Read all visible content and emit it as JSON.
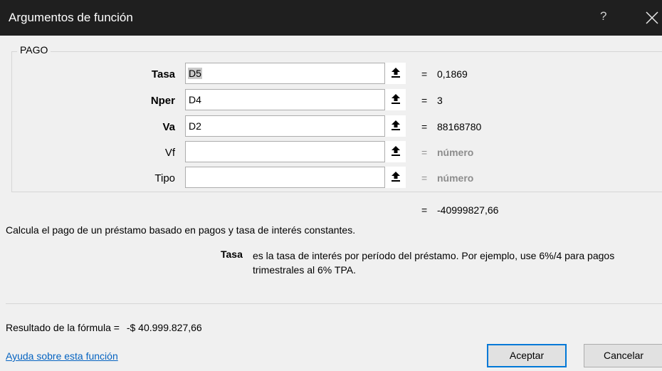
{
  "dialog": {
    "title": "Argumentos de función",
    "help_glyph": "?",
    "close_label": "X"
  },
  "function_name": "PAGO",
  "arguments": [
    {
      "label": "Tasa",
      "value": "D5",
      "result": "0,1869",
      "required": true
    },
    {
      "label": "Nper",
      "value": "D4",
      "result": "3",
      "required": true
    },
    {
      "label": "Va",
      "value": "D2",
      "result": "88168780",
      "required": true
    },
    {
      "label": "Vf",
      "value": "",
      "result": "número",
      "required": false
    },
    {
      "label": "Tipo",
      "value": "",
      "result": "número",
      "required": false
    }
  ],
  "equals_sign": "=",
  "total_result": "-40999827,66",
  "function_description": "Calcula el pago de un préstamo basado en pagos y tasa de interés constantes.",
  "argument_help": {
    "name": "Tasa",
    "text": "es la tasa de interés por período del préstamo. Por ejemplo, use 6%/4 para pagos trimestrales al 6% TPA."
  },
  "formula_result": {
    "label": "Resultado de la fórmula =",
    "value": "-$ 40.999.827,66"
  },
  "help_link": "Ayuda sobre esta función",
  "buttons": {
    "ok": "Aceptar",
    "cancel": "Cancelar"
  },
  "icons": {
    "ref_button": "collapse-dialog-arrow-icon",
    "close": "close-icon"
  },
  "colors": {
    "titlebar": "#1f1f1f",
    "link": "#0563c1",
    "default_button_border": "#0078d7"
  }
}
